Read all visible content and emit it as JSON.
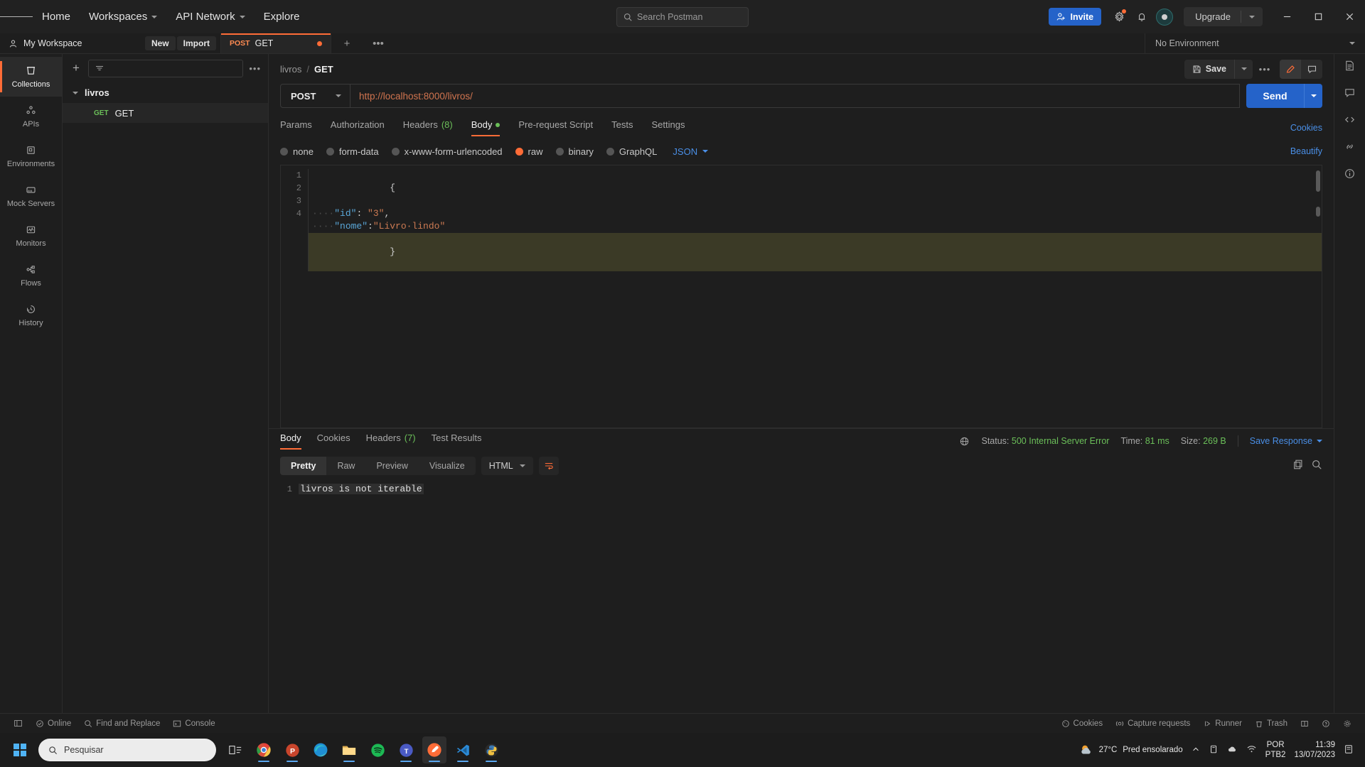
{
  "topbar": {
    "nav": [
      {
        "label": "Home",
        "has_caret": false
      },
      {
        "label": "Workspaces",
        "has_caret": true
      },
      {
        "label": "API Network",
        "has_caret": true
      },
      {
        "label": "Explore",
        "has_caret": false
      }
    ],
    "search_placeholder": "Search Postman",
    "invite_label": "Invite",
    "upgrade_label": "Upgrade"
  },
  "workspace": {
    "name": "My Workspace",
    "new_label": "New",
    "import_label": "Import",
    "environment_label": "No Environment"
  },
  "tab": {
    "method": "POST",
    "name": "GET"
  },
  "rail": [
    {
      "label": "Collections",
      "icon": "collections-icon",
      "active": true
    },
    {
      "label": "APIs",
      "icon": "apis-icon",
      "active": false
    },
    {
      "label": "Environments",
      "icon": "environments-icon",
      "active": false
    },
    {
      "label": "Mock Servers",
      "icon": "mock-servers-icon",
      "active": false
    },
    {
      "label": "Monitors",
      "icon": "monitors-icon",
      "active": false
    },
    {
      "label": "Flows",
      "icon": "flows-icon",
      "active": false
    },
    {
      "label": "History",
      "icon": "history-icon",
      "active": false
    }
  ],
  "sidebar": {
    "collection_name": "livros",
    "request": {
      "method": "GET",
      "name": "GET"
    }
  },
  "request": {
    "breadcrumb_collection": "livros",
    "breadcrumb_separator": "/",
    "breadcrumb_current": "GET",
    "save_label": "Save",
    "method": "POST",
    "url": "http://localhost:8000/livros/",
    "send_label": "Send",
    "tabs": [
      {
        "label": "Params",
        "badge": "",
        "active": false,
        "dot": false
      },
      {
        "label": "Authorization",
        "badge": "",
        "active": false,
        "dot": false
      },
      {
        "label": "Headers",
        "badge": "(8)",
        "active": false,
        "dot": false
      },
      {
        "label": "Body",
        "badge": "",
        "active": true,
        "dot": true
      },
      {
        "label": "Pre-request Script",
        "badge": "",
        "active": false,
        "dot": false
      },
      {
        "label": "Tests",
        "badge": "",
        "active": false,
        "dot": false
      },
      {
        "label": "Settings",
        "badge": "",
        "active": false,
        "dot": false
      }
    ],
    "cookies_label": "Cookies",
    "body_types": [
      {
        "label": "none",
        "selected": false
      },
      {
        "label": "form-data",
        "selected": false
      },
      {
        "label": "x-www-form-urlencoded",
        "selected": false
      },
      {
        "label": "raw",
        "selected": true
      },
      {
        "label": "binary",
        "selected": false
      },
      {
        "label": "GraphQL",
        "selected": false
      }
    ],
    "body_format": "JSON",
    "beautify_label": "Beautify",
    "body_lines": [
      {
        "n": "1",
        "type": "brace",
        "text": "{"
      },
      {
        "n": "2",
        "type": "pair",
        "key": "\"id\"",
        "colon": ": ",
        "value": "\"3\"",
        "comma": ","
      },
      {
        "n": "3",
        "type": "pair",
        "key": "\"nome\"",
        "colon": ":",
        "value": "\"Livro·lindo\"",
        "comma": ""
      },
      {
        "n": "4",
        "type": "brace",
        "text": "}"
      }
    ]
  },
  "response": {
    "tabs": [
      {
        "label": "Body",
        "badge": "",
        "active": true
      },
      {
        "label": "Cookies",
        "badge": "",
        "active": false
      },
      {
        "label": "Headers",
        "badge": "(7)",
        "active": false
      },
      {
        "label": "Test Results",
        "badge": "",
        "active": false
      }
    ],
    "status_label": "Status:",
    "status_value": "500 Internal Server Error",
    "time_label": "Time:",
    "time_value": "81 ms",
    "size_label": "Size:",
    "size_value": "269 B",
    "save_response_label": "Save Response",
    "view_modes": [
      {
        "label": "Pretty",
        "active": true
      },
      {
        "label": "Raw",
        "active": false
      },
      {
        "label": "Preview",
        "active": false
      },
      {
        "label": "Visualize",
        "active": false
      }
    ],
    "format": "HTML",
    "body_line_number": "1",
    "body_text": "livros is not iterable"
  },
  "footer": {
    "left": [
      {
        "label": "Online",
        "icon": "online-icon"
      },
      {
        "label": "Find and Replace",
        "icon": "search-icon"
      },
      {
        "label": "Console",
        "icon": "console-icon"
      }
    ],
    "right": [
      {
        "label": "Cookies",
        "icon": "cookie-icon"
      },
      {
        "label": "Capture requests",
        "icon": "capture-icon"
      },
      {
        "label": "Runner",
        "icon": "runner-icon"
      },
      {
        "label": "Trash",
        "icon": "trash-icon"
      }
    ]
  },
  "taskbar": {
    "search_placeholder": "Pesquisar",
    "temperature": "27°C",
    "weather_text": "Pred ensolarado",
    "lang_top": "POR",
    "lang_bottom": "PTB2",
    "time": "11:39",
    "date": "13/07/2023"
  },
  "colors": {
    "accent": "#ff6c37",
    "blue": "#2563c9",
    "link": "#4a8fe7",
    "green": "#6bbf59",
    "bg": "#1e1e1e"
  }
}
